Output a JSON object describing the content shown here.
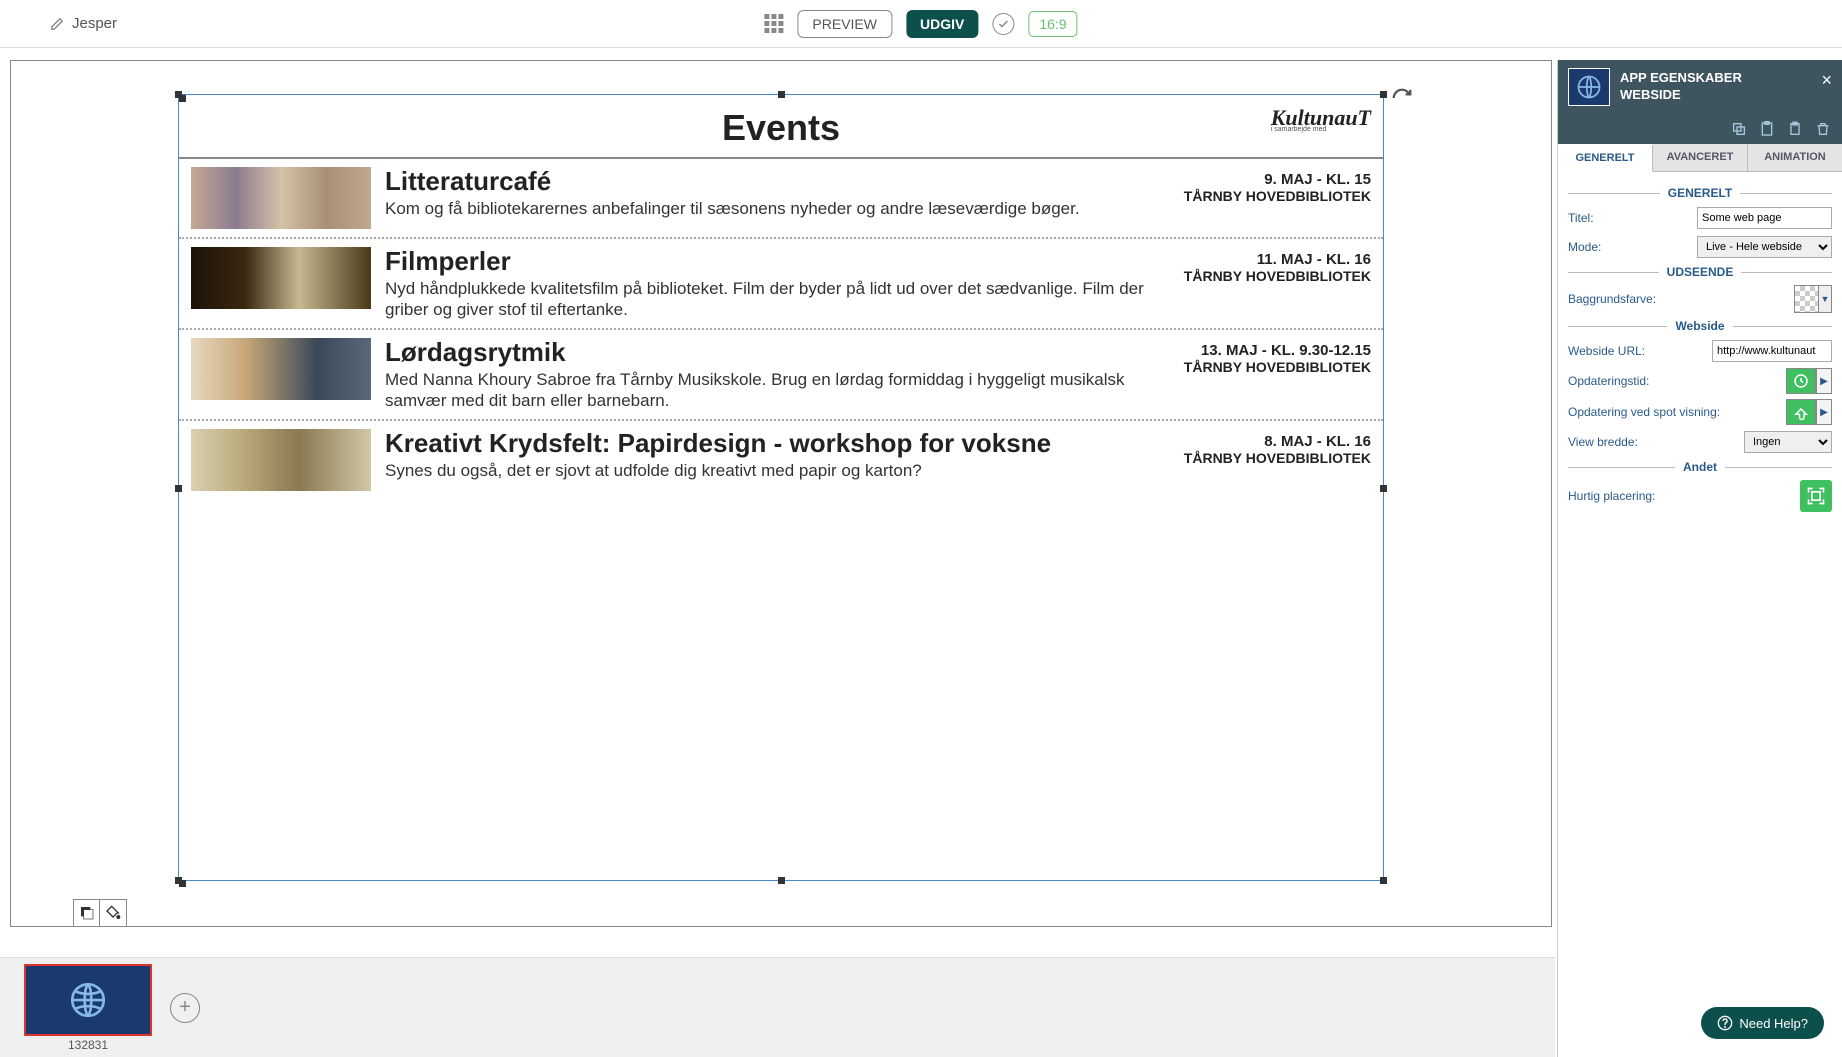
{
  "topbar": {
    "username": "Jesper",
    "preview": "PREVIEW",
    "udgiv": "UDGIV",
    "aspect": "16:9"
  },
  "canvas": {
    "title": "Events",
    "logo": "KultunauT",
    "logo_sub": "i samarbejde med",
    "events": [
      {
        "title": "Litteraturcafé",
        "desc": "Kom og få bibliotekarernes anbefalinger til sæsonens nyheder og andre læseværdige bøger.",
        "date": "9. MAJ - KL. 15",
        "place": "TÅRNBY HOVEDBIBLIOTEK"
      },
      {
        "title": "Filmperler",
        "desc": "Nyd håndplukkede kvalitetsfilm på biblioteket. Film der byder på lidt ud over det sædvanlige. Film der griber og giver stof til eftertanke.",
        "date": "11. MAJ - KL. 16",
        "place": "TÅRNBY HOVEDBIBLIOTEK"
      },
      {
        "title": "Lørdagsrytmik",
        "desc": "Med Nanna Khoury Sabroe fra Tårnby Musikskole. Brug en lørdag formiddag i hyggeligt musikalsk samvær med dit barn eller barnebarn.",
        "date": "13. MAJ - KL. 9.30-12.15",
        "place": "TÅRNBY HOVEDBIBLIOTEK"
      },
      {
        "title": "Kreativt Krydsfelt: Papirdesign - workshop for voksne",
        "desc": "Synes du også, det er sjovt at udfolde dig kreativt med papir og karton?",
        "date": "8. MAJ - KL. 16",
        "place": "TÅRNBY HOVEDBIBLIOTEK"
      }
    ]
  },
  "bottom": {
    "spot_id": "132831"
  },
  "panel": {
    "header1": "APP EGENSKABER",
    "header2": "WEBSIDE",
    "tabs": {
      "generelt": "GENERELT",
      "avanceret": "AVANCERET",
      "animation": "ANIMATION"
    },
    "sec_generelt": "GENERELT",
    "sec_udseende": "UDSEENDE",
    "sec_webside": "Webside",
    "sec_andet": "Andet",
    "titel_label": "Titel:",
    "titel_value": "Some web page",
    "mode_label": "Mode:",
    "mode_value": "Live - Hele webside",
    "bg_label": "Baggrundsfarve:",
    "url_label": "Webside URL:",
    "url_value": "http://www.kultunaut",
    "refresh_label": "Opdateringstid:",
    "refresh_spot_label": "Opdatering ved spot visning:",
    "view_width_label": "View bredde:",
    "view_width_value": "Ingen",
    "quick_label": "Hurtig placering:"
  },
  "help": "Need Help?"
}
